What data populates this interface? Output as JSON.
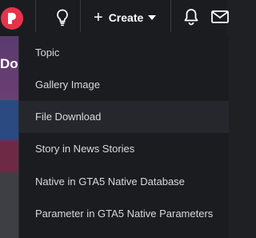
{
  "header": {
    "create_label": "Create"
  },
  "background": {
    "partial_heading": "Do"
  },
  "create_menu": {
    "items": [
      {
        "label": "Topic"
      },
      {
        "label": "Gallery Image"
      },
      {
        "label": "File Download"
      },
      {
        "label": "Story in News Stories"
      },
      {
        "label": "Native in GTA5 Native Database"
      },
      {
        "label": "Parameter in GTA5 Native Parameters"
      }
    ]
  },
  "colors": {
    "accent": "#e8324a",
    "menu_bg": "#1b1c20",
    "hover_bg": "#26272c"
  },
  "icons": [
    "user-avatar",
    "lightbulb-icon",
    "plus-icon",
    "caret-down-icon",
    "bell-icon",
    "mail-icon"
  ]
}
